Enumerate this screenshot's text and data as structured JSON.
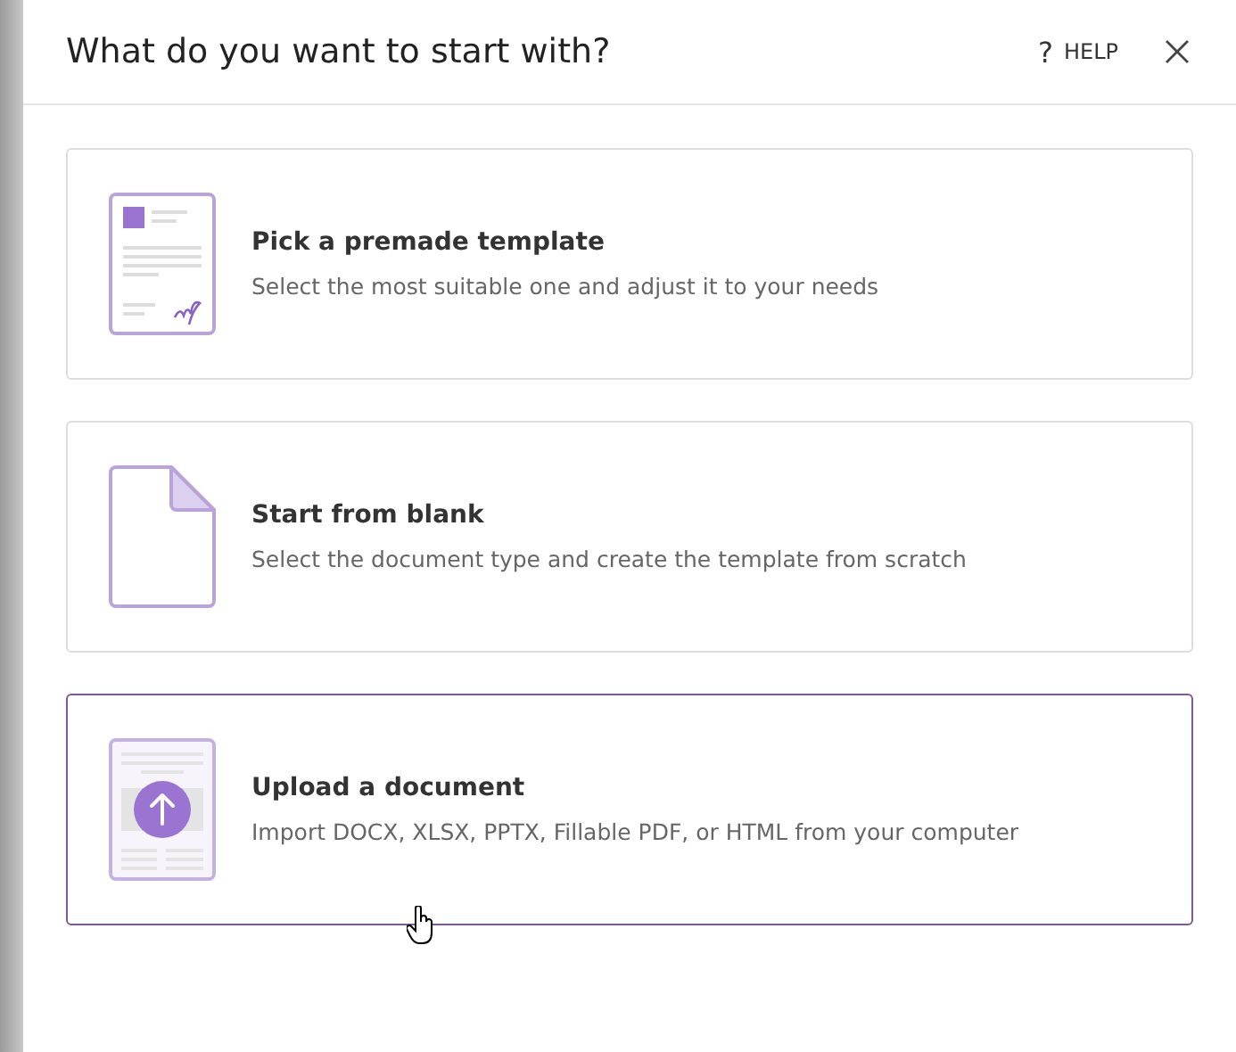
{
  "dialog": {
    "title": "What do you want to start with?",
    "help": {
      "icon": "?",
      "label": "HELP"
    }
  },
  "options": [
    {
      "kind": "template",
      "title": "Pick a premade template",
      "description": "Select the most suitable one and adjust it to your needs",
      "hovered": false
    },
    {
      "kind": "blank",
      "title": "Start from blank",
      "description": "Select the document type and create the template from scratch",
      "hovered": false
    },
    {
      "kind": "upload",
      "title": "Upload a document",
      "description": "Import DOCX, XLSX, PPTX, Fillable PDF, or HTML from your computer",
      "hovered": true
    }
  ]
}
